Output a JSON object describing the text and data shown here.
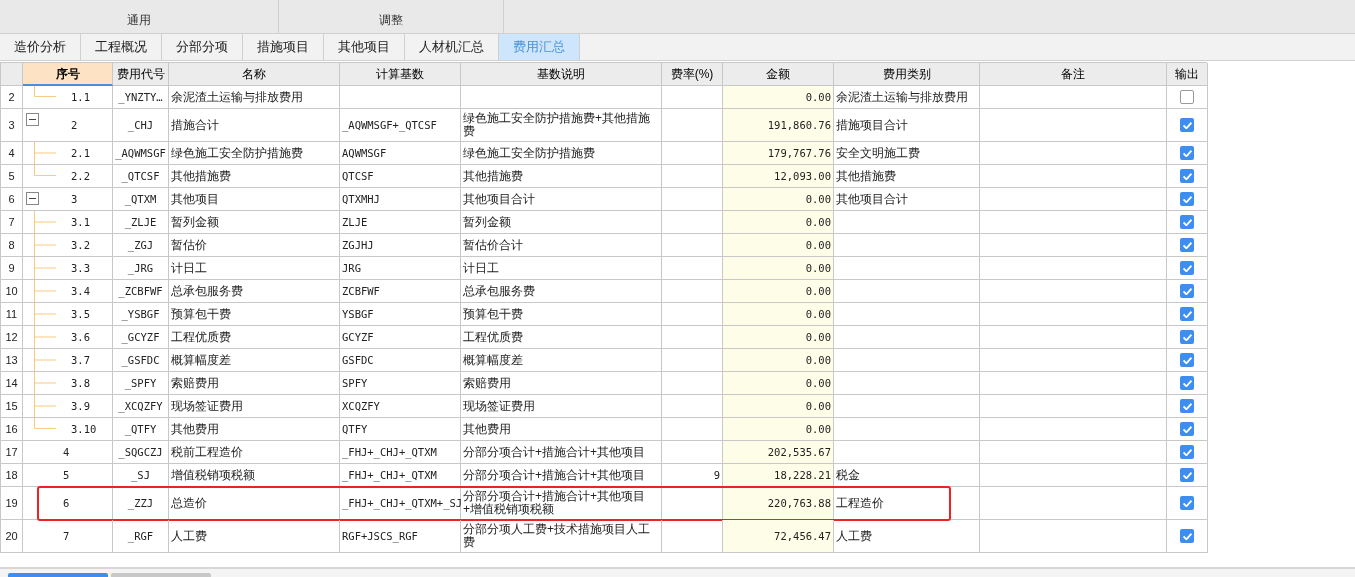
{
  "ribbon_groups": [
    {
      "label": "通用"
    },
    {
      "label": "调整"
    }
  ],
  "tabs": [
    {
      "label": "造价分析",
      "selected": false
    },
    {
      "label": "工程概况",
      "selected": false
    },
    {
      "label": "分部分项",
      "selected": false
    },
    {
      "label": "措施项目",
      "selected": false
    },
    {
      "label": "其他项目",
      "selected": false
    },
    {
      "label": "人材机汇总",
      "selected": false
    },
    {
      "label": "费用汇总",
      "selected": true
    }
  ],
  "table": {
    "columns": [
      {
        "label": "序号",
        "selected": true
      },
      {
        "label": "费用代号",
        "selected": false
      },
      {
        "label": "名称",
        "selected": false
      },
      {
        "label": "计算基数",
        "selected": false
      },
      {
        "label": "基数说明",
        "selected": false
      },
      {
        "label": "费率(%)",
        "selected": false
      },
      {
        "label": "金额",
        "selected": false
      },
      {
        "label": "费用类别",
        "selected": false
      },
      {
        "label": "备注",
        "selected": false
      },
      {
        "label": "输出",
        "selected": false
      }
    ],
    "rows": [
      {
        "kind": "child",
        "row": "2",
        "seq": "1.1",
        "code": "_YNZTY…",
        "name": "余泥渣土运输与排放费用",
        "amount": "0.00",
        "category": "余泥渣土运输与排放费用",
        "output": false,
        "highlighted": false
      },
      {
        "kind": "item",
        "row": "3",
        "seq": "2",
        "code": "_CHJ",
        "name": "措施合计",
        "base": "_AQWMSGF+_QTCSF",
        "base_desc": "绿色施工安全防护措施费+其他措施费",
        "amount": "191,860.76",
        "category": "措施项目合计",
        "output": true,
        "highlighted": false,
        "expanded": true,
        "children": [
          {
            "kind": "item",
            "row": "4",
            "seq": "2.1",
            "code": "_AQWMSGF",
            "name": "绿色施工安全防护措施费",
            "base": "AQWMSGF",
            "base_desc": "绿色施工安全防护措施费",
            "amount": "179,767.76",
            "category": "安全文明施工费",
            "output": true,
            "highlighted": false
          },
          {
            "kind": "item",
            "row": "5",
            "seq": "2.2",
            "code": "_QTCSF",
            "name": "其他措施费",
            "base": "QTCSF",
            "base_desc": "其他措施费",
            "amount": "12,093.00",
            "category": "其他措施费",
            "output": true,
            "highlighted": false
          }
        ]
      },
      {
        "kind": "item",
        "row": "6",
        "seq": "3",
        "code": "_QTXM",
        "name": "其他项目",
        "base": "QTXMHJ",
        "base_desc": "其他项目合计",
        "amount": "0.00",
        "category": "其他项目合计",
        "output": true,
        "highlighted": false,
        "expanded": true,
        "children": [
          {
            "kind": "item",
            "row": "7",
            "seq": "3.1",
            "code": "_ZLJE",
            "name": "暂列金额",
            "base": "ZLJE",
            "base_desc": "暂列金额",
            "amount": "0.00",
            "output": true,
            "highlighted": false
          },
          {
            "kind": "item",
            "row": "8",
            "seq": "3.2",
            "code": "_ZGJ",
            "name": "暂估价",
            "base": "ZGJHJ",
            "base_desc": "暂估价合计",
            "amount": "0.00",
            "output": true,
            "highlighted": false
          },
          {
            "kind": "item",
            "row": "9",
            "seq": "3.3",
            "code": "_JRG",
            "name": "计日工",
            "base": "JRG",
            "base_desc": "计日工",
            "amount": "0.00",
            "output": true,
            "highlighted": false
          },
          {
            "kind": "item",
            "row": "10",
            "seq": "3.4",
            "code": "_ZCBFWF",
            "name": "总承包服务费",
            "base": "ZCBFWF",
            "base_desc": "总承包服务费",
            "amount": "0.00",
            "output": true,
            "highlighted": false
          },
          {
            "kind": "item",
            "row": "11",
            "seq": "3.5",
            "code": "_YSBGF",
            "name": "预算包干费",
            "base": "YSBGF",
            "base_desc": "预算包干费",
            "amount": "0.00",
            "output": true,
            "highlighted": false
          },
          {
            "kind": "item",
            "row": "12",
            "seq": "3.6",
            "code": "_GCYZF",
            "name": "工程优质费",
            "base": "GCYZF",
            "base_desc": "工程优质费",
            "amount": "0.00",
            "output": true,
            "highlighted": false
          },
          {
            "kind": "item",
            "row": "13",
            "seq": "3.7",
            "code": "_GSFDC",
            "name": "概算幅度差",
            "base": "GSFDC",
            "base_desc": "概算幅度差",
            "amount": "0.00",
            "output": true,
            "highlighted": false
          },
          {
            "kind": "item",
            "row": "14",
            "seq": "3.8",
            "code": "_SPFY",
            "name": "索赔费用",
            "base": "SPFY",
            "base_desc": "索赔费用",
            "amount": "0.00",
            "output": true,
            "highlighted": false
          },
          {
            "kind": "item",
            "row": "15",
            "seq": "3.9",
            "code": "_XCQZFY",
            "name": "现场签证费用",
            "base": "XCQZFY",
            "base_desc": "现场签证费用",
            "amount": "0.00",
            "output": true,
            "highlighted": false
          },
          {
            "kind": "item",
            "row": "16",
            "seq": "3.10",
            "code": "_QTFY",
            "name": "其他费用",
            "base": "QTFY",
            "base_desc": "其他费用",
            "amount": "0.00",
            "output": true,
            "highlighted": false
          }
        ]
      },
      {
        "kind": "item",
        "row": "17",
        "seq": "4",
        "code": "_SQGCZJ",
        "name": "税前工程造价",
        "base": "_FHJ+_CHJ+_QTXM",
        "base_desc": "分部分项合计+措施合计+其他项目",
        "amount": "202,535.67",
        "output": true,
        "highlighted": false
      },
      {
        "kind": "item",
        "row": "18",
        "seq": "5",
        "code": "_SJ",
        "name": "增值税销项税额",
        "base": "_FHJ+_CHJ+_QTXM",
        "base_desc": "分部分项合计+措施合计+其他项目",
        "rate": "9",
        "amount": "18,228.21",
        "category": "税金",
        "output": true,
        "highlighted": false
      },
      {
        "kind": "item",
        "row": "19",
        "seq": "6",
        "code": "_ZZJ",
        "name": "总造价",
        "base": "_FHJ+_CHJ+_QTXM+_SJ",
        "base_desc": "分部分项合计+措施合计+其他项目+增值税销项税额",
        "amount": "220,763.88",
        "category": "工程造价",
        "output": true,
        "highlighted": true
      },
      {
        "kind": "item",
        "row": "20",
        "seq": "7",
        "code": "_RGF",
        "name": "人工费",
        "base": "RGF+JSCS_RGF",
        "base_desc": "分部分项人工费+技术措施项目人工费",
        "amount": "72,456.47",
        "category": "人工费",
        "output": true,
        "highlighted": false
      }
    ]
  }
}
